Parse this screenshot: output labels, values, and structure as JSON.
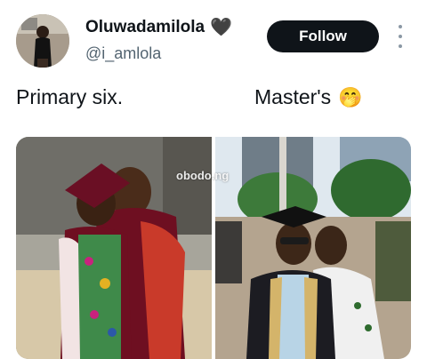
{
  "profile": {
    "display_name": "Oluwadamilola",
    "name_emoji": "🖤",
    "handle": "@i_amlola"
  },
  "actions": {
    "follow_label": "Follow"
  },
  "tweet": {
    "text_left": "Primary six.",
    "text_right": "Master's",
    "text_right_glyph": "",
    "text_right_emoji": "🤭"
  },
  "media": {
    "watermark": "obodo.ng",
    "images": [
      {
        "description_icon": "graduation-child-photo"
      },
      {
        "description_icon": "graduation-masters-photo"
      }
    ]
  },
  "colors": {
    "follow_bg": "#0f1419",
    "handle_text": "#536471"
  }
}
